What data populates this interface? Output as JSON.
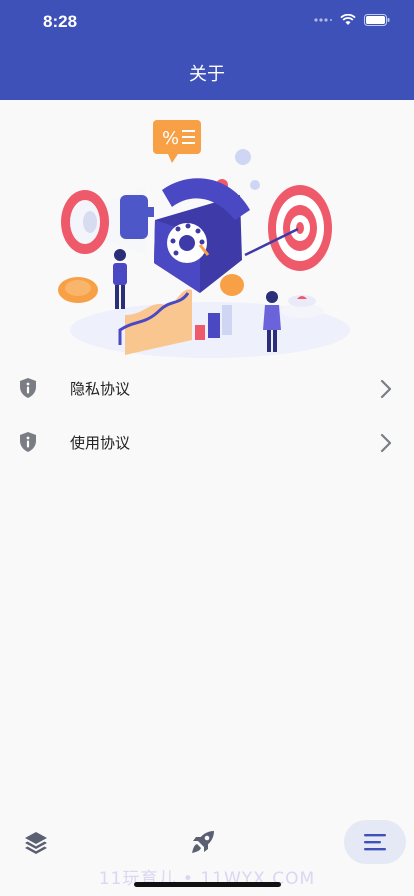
{
  "status": {
    "time": "8:28"
  },
  "header": {
    "title": "关于"
  },
  "hero": {
    "alt": "marketing-illustration"
  },
  "menu": [
    {
      "label": "隐私协议",
      "icon": "info-shield-icon"
    },
    {
      "label": "使用协议",
      "icon": "info-shield-icon"
    }
  ],
  "tabbar": {
    "items": [
      "layers-icon",
      "rocket-icon",
      "menu-icon"
    ],
    "active": "menu-icon"
  },
  "watermark": "11玩育儿 • 11WYX.COM",
  "colors": {
    "brand": "#3d51b8",
    "active_tab_bg": "#e5e8f5"
  }
}
